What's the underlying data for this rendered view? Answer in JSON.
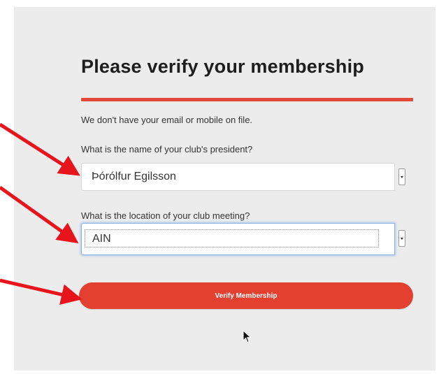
{
  "form": {
    "title": "Please verify your membership",
    "info_text": "We don't have your email or mobile on file.",
    "question1": {
      "label": "What is the name of your club's president?",
      "selected_value": "Þórólfur Egilsson"
    },
    "question2": {
      "label": "What is the location of your club meeting?",
      "selected_value": "AIN"
    },
    "submit_label": "Verify Membership"
  },
  "colors": {
    "accent": "#e2483a",
    "panel_background": "#ececed",
    "annotation_arrow": "#e8141c"
  },
  "icons": {
    "cursor": "mouse-pointer-icon",
    "dropdown": "chevron-down-icon",
    "annotation": "red-arrow-icon"
  }
}
